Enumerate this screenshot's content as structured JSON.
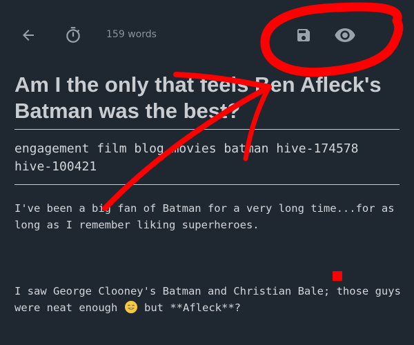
{
  "toolbar": {
    "back_icon": "arrow-left-icon",
    "timer_icon": "stopwatch-icon",
    "word_count": "159 words",
    "save_icon": "save-icon",
    "preview_icon": "eye-icon"
  },
  "post": {
    "title": "Am I the only that feels Ben Afleck's Batman was the best?",
    "tags": "engagement film blog movies batman hive-174578 hive-100421",
    "paragraphs": [
      "I've been a big fan of Batman for a very long time...for as long as I remember liking superheroes.",
      "I saw George Clooney's Batman and Christian Bale; those guys were neat enough",
      "but **Afleck**?"
    ],
    "emoji_icon": "smiling-face-icon"
  },
  "colors": {
    "background": "#1f2731",
    "icon": "#9aa3ac",
    "annotation": "#ff0000"
  }
}
